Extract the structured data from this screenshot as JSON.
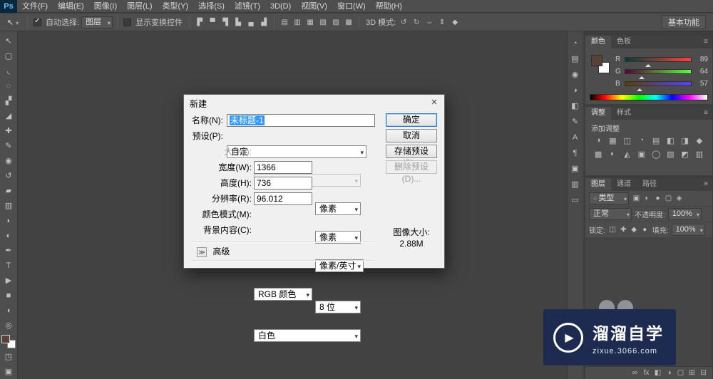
{
  "app": {
    "logo": "Ps"
  },
  "menu": {
    "items": [
      {
        "label": "文件(F)"
      },
      {
        "label": "编辑(E)"
      },
      {
        "label": "图像(I)"
      },
      {
        "label": "图层(L)"
      },
      {
        "label": "类型(Y)"
      },
      {
        "label": "选择(S)"
      },
      {
        "label": "滤镜(T)"
      },
      {
        "label": "3D(D)"
      },
      {
        "label": "视图(V)"
      },
      {
        "label": "窗口(W)"
      },
      {
        "label": "帮助(H)"
      }
    ]
  },
  "options": {
    "tool_icon": "↖",
    "auto_select": "自动选择:",
    "auto_select_value": "图层",
    "show_transform": "显示变换控件",
    "align_icons": [
      "▛",
      "▀",
      "▜",
      "▙",
      "▄",
      "▟"
    ],
    "distribute_icons": [
      "▤",
      "▥",
      "▦",
      "▧",
      "▨",
      "▩"
    ],
    "mode_label": "3D 模式:",
    "mode_icons": [
      "↺",
      "↻",
      "⇔",
      "⇕",
      "◆"
    ],
    "workspace": "基本功能"
  },
  "toolbar": {
    "tools": [
      {
        "name": "move-tool",
        "glyph": "↖"
      },
      {
        "name": "marquee-tool",
        "glyph": "▢"
      },
      {
        "name": "lasso-tool",
        "glyph": "◟"
      },
      {
        "name": "quick-selection-tool",
        "glyph": "◌"
      },
      {
        "name": "crop-tool",
        "glyph": "▞"
      },
      {
        "name": "eyedropper-tool",
        "glyph": "◢"
      },
      {
        "name": "healing-brush-tool",
        "glyph": "✚"
      },
      {
        "name": "brush-tool",
        "glyph": "✎"
      },
      {
        "name": "clone-stamp-tool",
        "glyph": "◉"
      },
      {
        "name": "history-brush-tool",
        "glyph": "↺"
      },
      {
        "name": "eraser-tool",
        "glyph": "▰"
      },
      {
        "name": "gradient-tool",
        "glyph": "▥"
      },
      {
        "name": "blur-tool",
        "glyph": "◗"
      },
      {
        "name": "dodge-tool",
        "glyph": "◐"
      },
      {
        "name": "pen-tool",
        "glyph": "✒"
      },
      {
        "name": "type-tool",
        "glyph": "T"
      },
      {
        "name": "path-selection-tool",
        "glyph": "▶"
      },
      {
        "name": "shape-tool",
        "glyph": "■"
      },
      {
        "name": "hand-tool",
        "glyph": "◖"
      },
      {
        "name": "zoom-tool",
        "glyph": "◎"
      }
    ],
    "extras": [
      {
        "name": "quick-mask-button",
        "glyph": "◳"
      },
      {
        "name": "screen-mode-button",
        "glyph": "▣"
      }
    ]
  },
  "dock": {
    "icons": [
      {
        "name": "history-panel-icon",
        "glyph": "◔"
      },
      {
        "name": "properties-panel-icon",
        "glyph": "▤"
      },
      {
        "name": "info-panel-icon",
        "glyph": "◉"
      },
      {
        "name": "adjustments-panel-icon",
        "glyph": "◑"
      },
      {
        "name": "masks-panel-icon",
        "glyph": "◧"
      },
      {
        "name": "brush-panel-icon",
        "glyph": "✎"
      },
      {
        "name": "character-panel-icon",
        "glyph": "A"
      },
      {
        "name": "paragraph-panel-icon",
        "glyph": "¶"
      },
      {
        "name": "clone-source-panel-icon",
        "glyph": "▣"
      },
      {
        "name": "timeline-panel-icon",
        "glyph": "▥"
      },
      {
        "name": "notes-panel-icon",
        "glyph": "▭"
      }
    ]
  },
  "panels": {
    "color": {
      "tabs": [
        "颜色",
        "色板"
      ],
      "sliders": [
        {
          "label": "R",
          "value": "89"
        },
        {
          "label": "G",
          "value": "64"
        },
        {
          "label": "B",
          "value": "57"
        }
      ]
    },
    "adjust": {
      "tabs": [
        "调整",
        "样式"
      ],
      "heading": "添加调整",
      "icons": [
        "◑",
        "▦",
        "◫",
        "◔",
        "▤",
        "◧",
        "◨",
        "◆",
        "▩",
        "◐",
        "◭",
        "▣",
        "◯",
        "▨",
        "◩",
        "▥"
      ]
    },
    "layers": {
      "tabs": [
        "图层",
        "通道",
        "路径"
      ],
      "filter_label": "类型",
      "filter_icons": [
        "▣",
        "◐",
        "●",
        "▢",
        "◈"
      ],
      "blend_mode": "正常",
      "opacity_label": "不透明度:",
      "opacity_value": "100%",
      "lock_label": "锁定:",
      "lock_icons": [
        "◫",
        "✚",
        "◆",
        "●"
      ],
      "fill_label": "填充:",
      "fill_value": "100%",
      "bottom_icons": [
        {
          "name": "link-layers-icon",
          "glyph": "∞"
        },
        {
          "name": "layer-effects-icon",
          "glyph": "fx"
        },
        {
          "name": "layer-mask-icon",
          "glyph": "◧"
        },
        {
          "name": "adjustment-layer-icon",
          "glyph": "◑"
        },
        {
          "name": "layer-group-icon",
          "glyph": "▢"
        },
        {
          "name": "new-layer-icon",
          "glyph": "⊞"
        },
        {
          "name": "delete-layer-icon",
          "glyph": "⊟"
        }
      ]
    }
  },
  "dialog": {
    "title": "新建",
    "close_icon": "✕",
    "name_label": "名称(N):",
    "name_value": "未标题-1",
    "preset_label": "预设(P):",
    "preset_value": "自定",
    "size_label": "大小(I):",
    "width_label": "宽度(W):",
    "width_value": "1366",
    "width_unit": "像素",
    "height_label": "高度(H):",
    "height_value": "736",
    "height_unit": "像素",
    "resolution_label": "分辨率(R):",
    "resolution_value": "96.012",
    "resolution_unit": "像素/英寸",
    "mode_label": "颜色模式(M):",
    "mode_value": "RGB 颜色",
    "mode_depth": "8 位",
    "background_label": "背景内容(C):",
    "background_value": "白色",
    "ok": "确定",
    "cancel": "取消",
    "save_preset": "存储预设(S)...",
    "delete_preset": "删除预设(D)...",
    "image_size_label": "图像大小:",
    "image_size_value": "2.88M",
    "advanced_icon": "≫",
    "advanced_label": "高级"
  },
  "watermark": {
    "play_icon": "▶",
    "title": "溜溜自学",
    "url": "zixue.3066.com"
  }
}
